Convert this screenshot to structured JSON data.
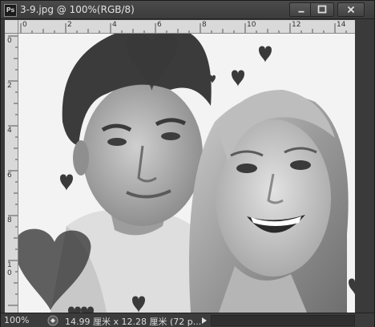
{
  "window": {
    "app_badge": "Ps",
    "title": "3-9.jpg @ 100%(RGB/8)"
  },
  "ruler_top": {
    "labels": [
      "0",
      "2",
      "4",
      "6",
      "8",
      "10",
      "12",
      "14"
    ]
  },
  "ruler_left": {
    "labels": [
      "0",
      "2",
      "4",
      "6",
      "8",
      "1\n0"
    ]
  },
  "status": {
    "zoom": "100%",
    "doc_info": "14.99 厘米 x 12.28 厘米 (72 p..."
  },
  "colors": {
    "chrome": "#3a3a3a",
    "ruler": "#d9d9d9",
    "canvas_bg": "#f2f2f2"
  }
}
